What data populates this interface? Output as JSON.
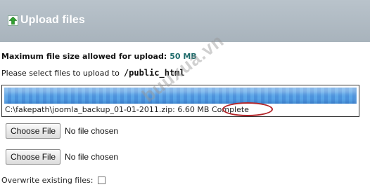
{
  "header": {
    "title": "Upload files",
    "icon": "upload-arrow-icon"
  },
  "limits": {
    "label": "Maximum file size allowed for upload:",
    "value": "50 MB"
  },
  "destination": {
    "label": "Please select files to upload to",
    "path": "/public_html"
  },
  "upload": {
    "progress_fraction": 1.0,
    "file_path": "C:\\fakepath\\joomla_backup_01-01-2011.zip:",
    "size": "6.60 MB",
    "status": "Complete"
  },
  "file_inputs": [
    {
      "button_label": "Choose File",
      "status": "No file chosen"
    },
    {
      "button_label": "Choose File",
      "status": "No file chosen"
    }
  ],
  "overwrite": {
    "label": "Overwrite existing files:",
    "checked": false
  },
  "watermark": "buuxua.vn",
  "colors": {
    "header": "#a9b4bd",
    "progress": "#4f9be3",
    "highlight_ring": "#b3262a",
    "size_value": "#1f6b6b"
  }
}
